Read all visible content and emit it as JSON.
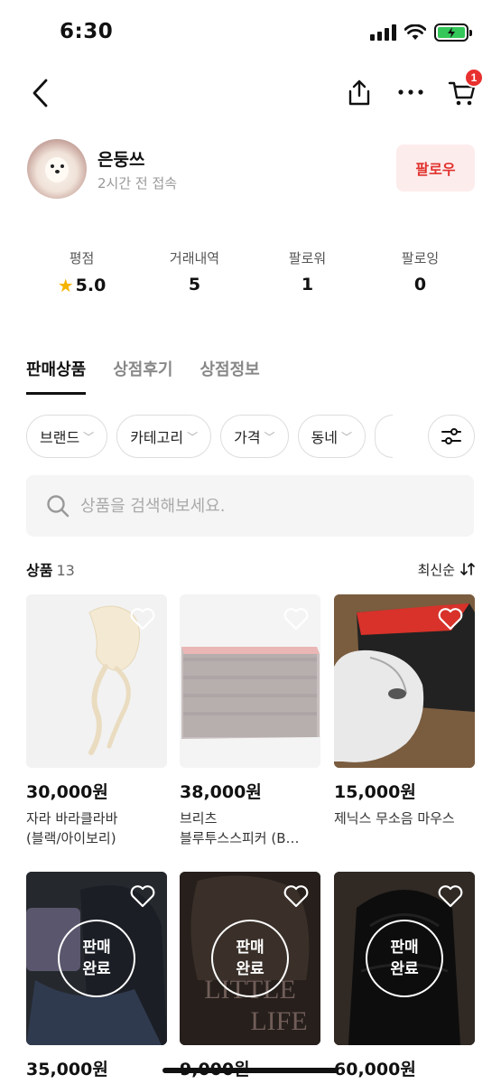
{
  "status": {
    "time": "6:30"
  },
  "nav": {
    "cart_badge": "1"
  },
  "profile": {
    "name": "은둥쓰",
    "last_seen": "2시간 전 접속",
    "follow_label": "팔로우"
  },
  "stats": [
    {
      "label": "평점",
      "value": "5.0"
    },
    {
      "label": "거래내역",
      "value": "5"
    },
    {
      "label": "팔로워",
      "value": "1"
    },
    {
      "label": "팔로잉",
      "value": "0"
    }
  ],
  "tabs": [
    "판매상품",
    "상점후기",
    "상점정보"
  ],
  "filters": [
    "브랜드",
    "카테고리",
    "가격",
    "동네"
  ],
  "search": {
    "placeholder": "상품을 검색해보세요."
  },
  "list": {
    "label": "상품",
    "count": "13",
    "sort_label": "최신순"
  },
  "products": [
    {
      "price": "30,000원",
      "title_line1": "자라 바라클라바",
      "title_line2": "(블랙/아이보리)",
      "sold": false
    },
    {
      "price": "38,000원",
      "title_line1": "브리츠",
      "title_line2": "블루투스스피커 (B…",
      "sold": false
    },
    {
      "price": "15,000원",
      "title_line1": "제닉스 무소음 마우스",
      "title_line2": "",
      "sold": false
    },
    {
      "price": "35,000원",
      "title_line1": "",
      "title_line2": "",
      "sold": true,
      "sold_label_1": "판매",
      "sold_label_2": "완료"
    },
    {
      "price": "9,000원",
      "title_line1": "",
      "title_line2": "",
      "sold": true,
      "sold_label_1": "판매",
      "sold_label_2": "완료"
    },
    {
      "price": "60,000원",
      "title_line1": "",
      "title_line2": "",
      "sold": true,
      "sold_label_1": "판매",
      "sold_label_2": "완료"
    }
  ],
  "colors": {
    "accent": "#e0322e",
    "follow_bg": "#fdecec",
    "badge": "#e8312e"
  }
}
